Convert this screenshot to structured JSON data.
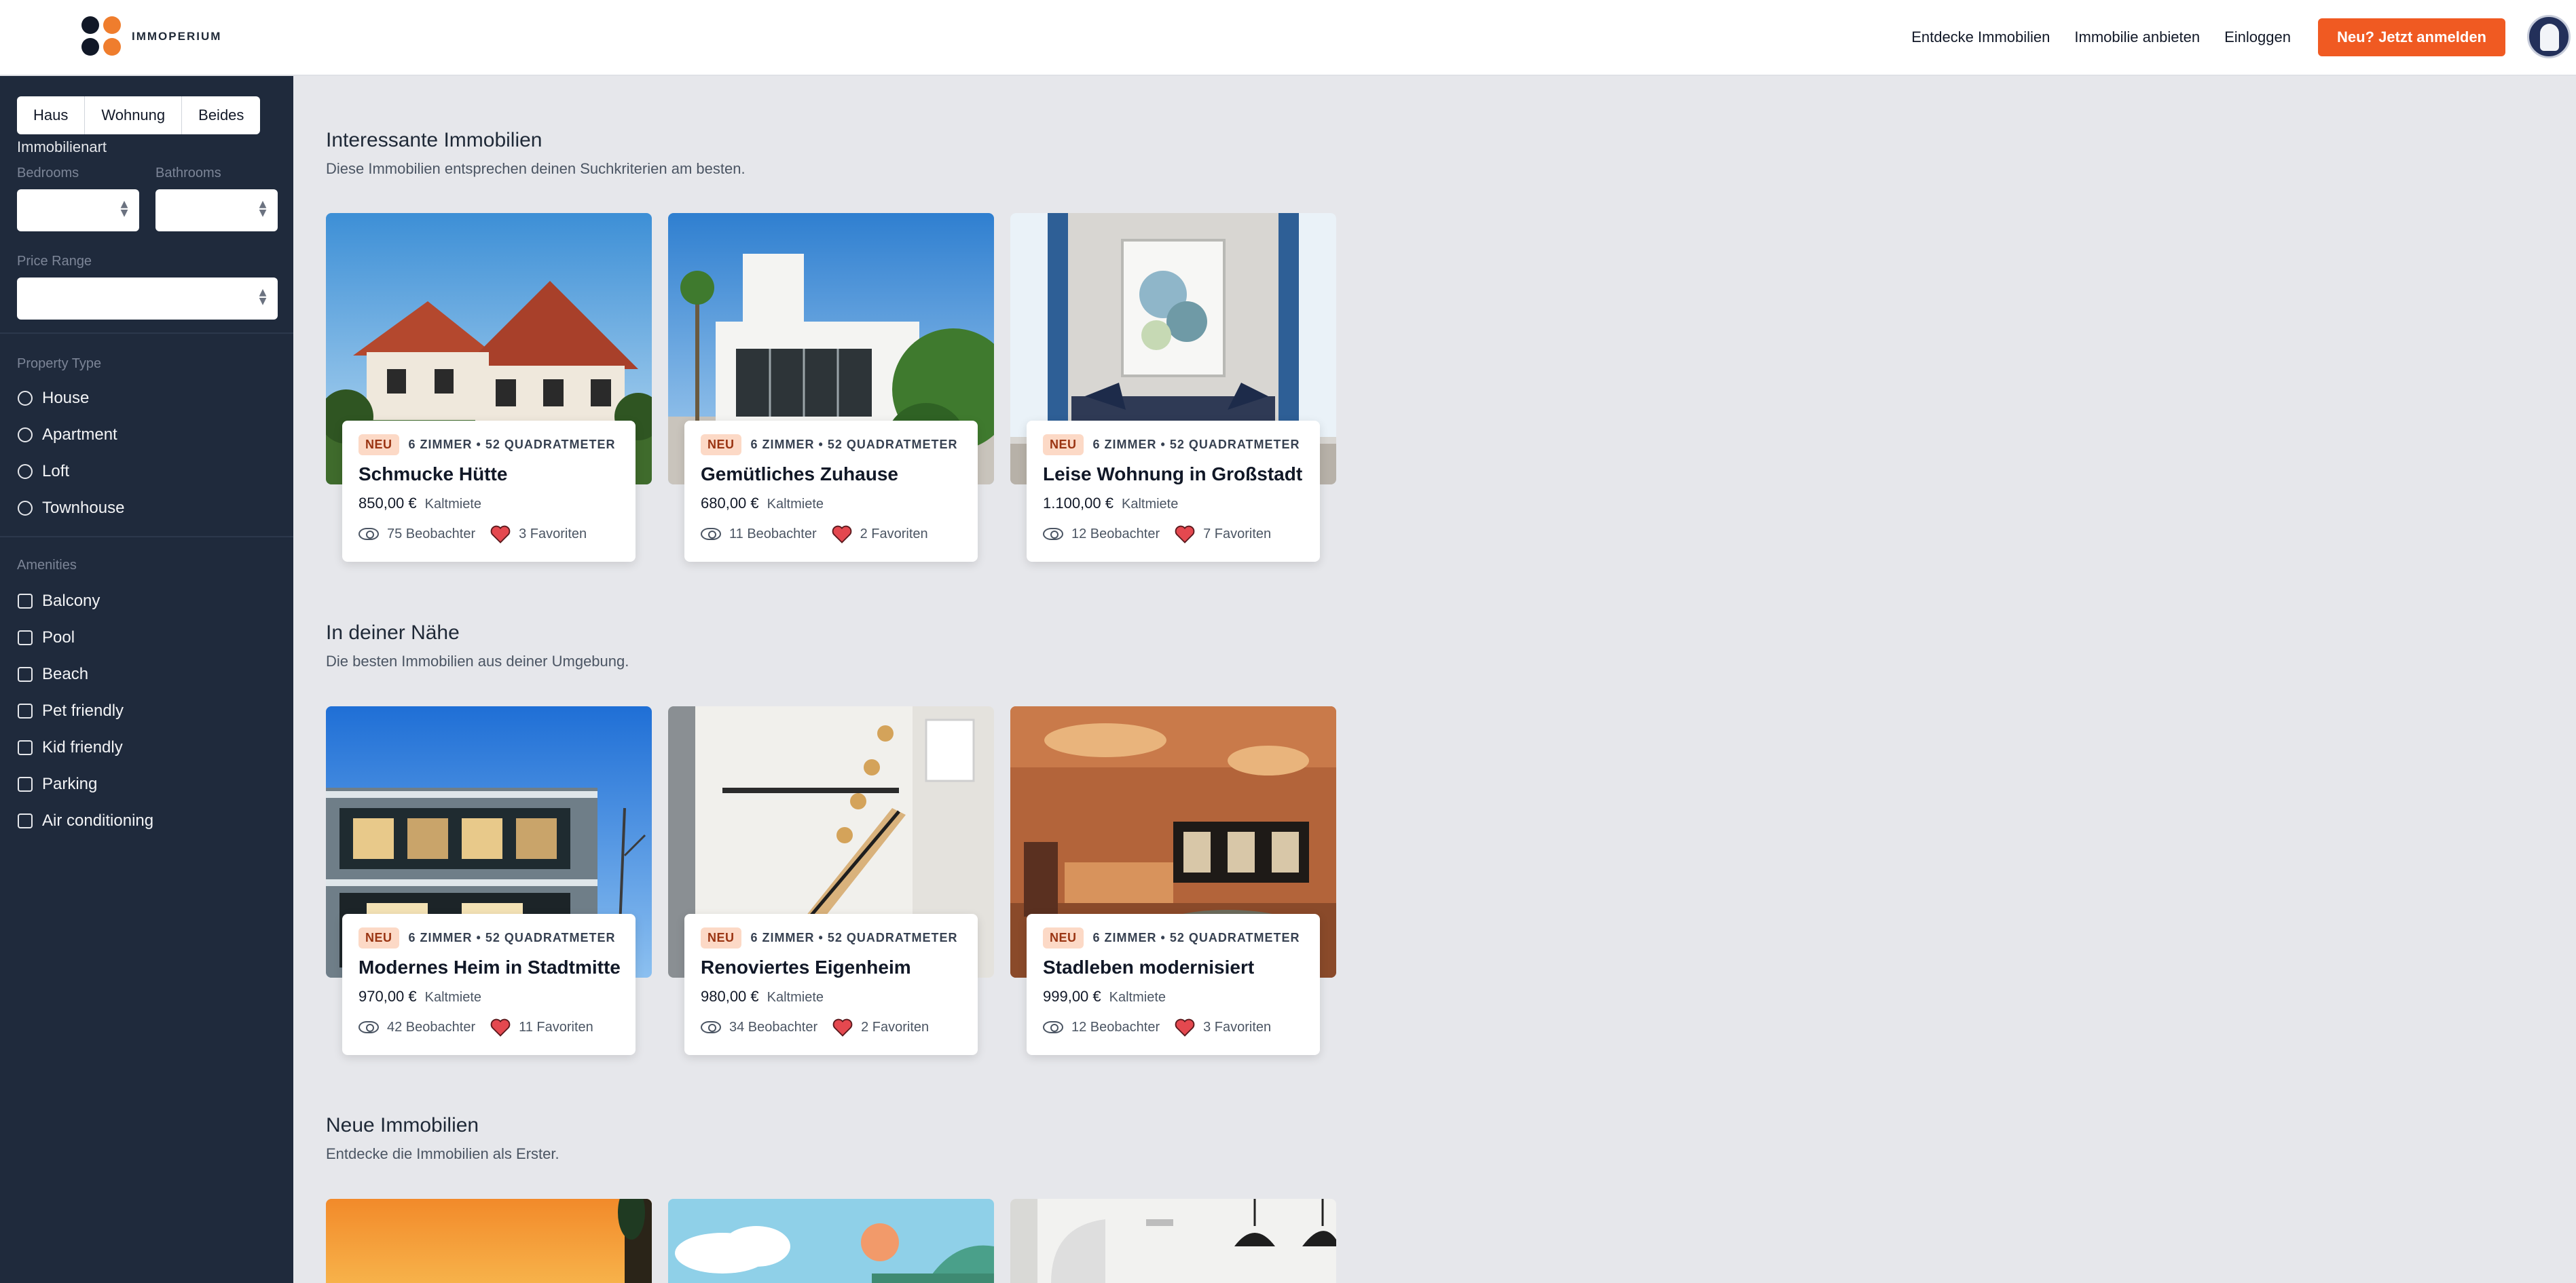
{
  "header": {
    "brand": "IMMOPERIUM",
    "nav": [
      "Entdecke Immobilien",
      "Immobilie anbieten",
      "Einloggen"
    ],
    "cta": "Neu? Jetzt anmelden"
  },
  "sidebar": {
    "segments": [
      "Haus",
      "Wohnung",
      "Beides"
    ],
    "segment_label": "Immobilienart",
    "bedrooms_label": "Bedrooms",
    "bathrooms_label": "Bathrooms",
    "price_label": "Price Range",
    "property_type_label": "Property Type",
    "property_types": [
      "House",
      "Apartment",
      "Loft",
      "Townhouse"
    ],
    "amenities_label": "Amenities",
    "amenities": [
      "Balcony",
      "Pool",
      "Beach",
      "Pet friendly",
      "Kid friendly",
      "Parking",
      "Air conditioning"
    ]
  },
  "sections": [
    {
      "title": "Interessante Immobilien",
      "subtitle": "Diese Immobilien entsprechen deinen Suchkriterien am besten.",
      "cards": [
        {
          "badge": "NEU",
          "meta": "6 ZIMMER • 52 QUADRATMETER",
          "title": "Schmucke Hütte",
          "price": "850,00 €",
          "unit": "Kaltmiete",
          "watchers": "75 Beobachter",
          "favorites": "3 Favoriten"
        },
        {
          "badge": "NEU",
          "meta": "6 ZIMMER • 52 QUADRATMETER",
          "title": "Gemütliches Zuhause",
          "price": "680,00 €",
          "unit": "Kaltmiete",
          "watchers": "11 Beobachter",
          "favorites": "2 Favoriten"
        },
        {
          "badge": "NEU",
          "meta": "6 ZIMMER • 52 QUADRATMETER",
          "title": "Leise Wohnung in Großstadt",
          "price": "1.100,00 €",
          "unit": "Kaltmiete",
          "watchers": "12 Beobachter",
          "favorites": "7 Favoriten"
        }
      ]
    },
    {
      "title": "In deiner Nähe",
      "subtitle": "Die besten Immobilien aus deiner Umgebung.",
      "cards": [
        {
          "badge": "NEU",
          "meta": "6 ZIMMER • 52 QUADRATMETER",
          "title": "Modernes Heim in Stadtmitte",
          "price": "970,00 €",
          "unit": "Kaltmiete",
          "watchers": "42 Beobachter",
          "favorites": "11 Favoriten"
        },
        {
          "badge": "NEU",
          "meta": "6 ZIMMER • 52 QUADRATMETER",
          "title": "Renoviertes Eigenheim",
          "price": "980,00 €",
          "unit": "Kaltmiete",
          "watchers": "34 Beobachter",
          "favorites": "2 Favoriten"
        },
        {
          "badge": "NEU",
          "meta": "6 ZIMMER • 52 QUADRATMETER",
          "title": "Stadleben modernisiert",
          "price": "999,00 €",
          "unit": "Kaltmiete",
          "watchers": "12 Beobachter",
          "favorites": "3 Favoriten"
        }
      ]
    },
    {
      "title": "Neue Immobilien",
      "subtitle": "Entdecke die Immobilien als Erster.",
      "cards": []
    }
  ],
  "colors": {
    "accent": "#f05a22",
    "sidebar": "#1f2a3c",
    "background": "#e6e7eb",
    "heart": "#e4484f"
  },
  "icons": {
    "watchers": "eye-icon",
    "favorites": "heart-icon"
  }
}
